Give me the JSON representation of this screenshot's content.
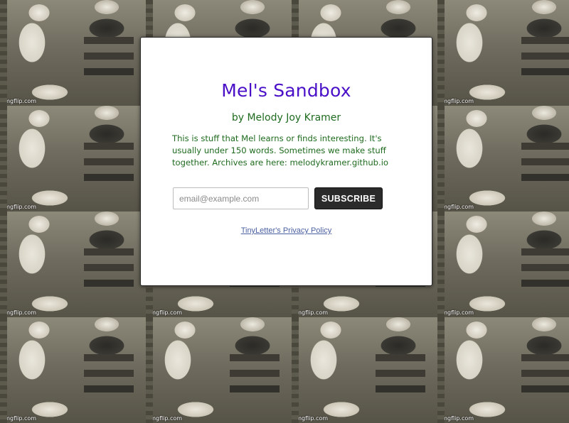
{
  "background": {
    "watermark": "imgflip.com",
    "tile_count": 16
  },
  "newsletter": {
    "title": "Mel's Sandbox",
    "byline": "by Melody Joy Kramer",
    "description": "This is stuff that Mel learns or finds interesting. It's usually under 150 words. Sometimes we make stuff together. Archives are here: melodykramer.github.io",
    "email_placeholder": "email@example.com",
    "email_value": "",
    "subscribe_label": "SUBSCRIBE",
    "privacy_link": "TinyLetter's Privacy Policy"
  },
  "colors": {
    "title": "#4a10c8",
    "text": "#1f6b1f",
    "button": "#2b2b2b",
    "link": "#4a5fa0"
  }
}
